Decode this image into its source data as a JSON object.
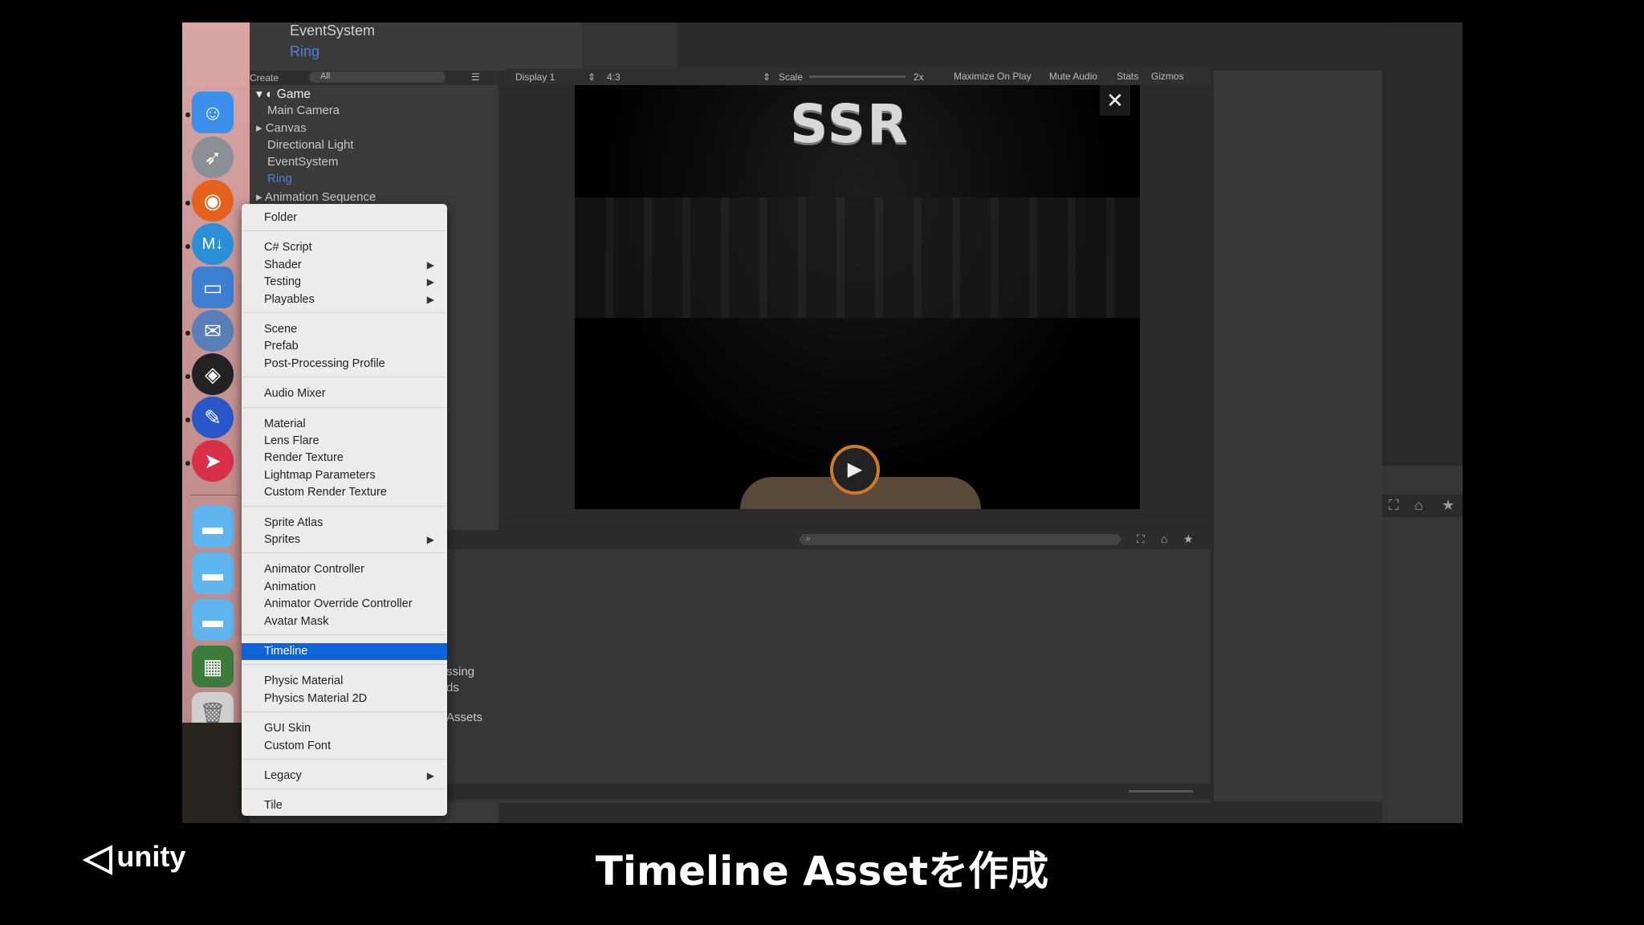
{
  "caption": "Timeline Assetを作成",
  "logo_text": "unity",
  "hierarchy_top": [
    "EventSystem",
    "Ring"
  ],
  "hierarchy_toolbar": {
    "create": "Create",
    "search": "All"
  },
  "hierarchy": {
    "scene": "Game",
    "items": [
      "Main Camera",
      "Canvas",
      "Directional Light",
      "EventSystem",
      "Ring",
      "Animation Sequence"
    ]
  },
  "game_toolbar": {
    "display": "Display 1",
    "aspect": "4:3",
    "scale_label": "Scale",
    "scale_value": "2x",
    "maximize": "Maximize On Play",
    "mute": "Mute Audio",
    "stats": "Stats",
    "gizmos": "Gizmos"
  },
  "game_logo": "SSR",
  "project_fragments": [
    "ssing",
    "ds",
    "Assets"
  ],
  "menu": {
    "groups": [
      [
        {
          "label": "Folder"
        }
      ],
      [
        {
          "label": "C# Script"
        },
        {
          "label": "Shader",
          "sub": true
        },
        {
          "label": "Testing",
          "sub": true
        },
        {
          "label": "Playables",
          "sub": true
        }
      ],
      [
        {
          "label": "Scene"
        },
        {
          "label": "Prefab"
        },
        {
          "label": "Post-Processing Profile"
        }
      ],
      [
        {
          "label": "Audio Mixer"
        }
      ],
      [
        {
          "label": "Material"
        },
        {
          "label": "Lens Flare"
        },
        {
          "label": "Render Texture"
        },
        {
          "label": "Lightmap Parameters"
        },
        {
          "label": "Custom Render Texture"
        }
      ],
      [
        {
          "label": "Sprite Atlas"
        },
        {
          "label": "Sprites",
          "sub": true
        }
      ],
      [
        {
          "label": "Animator Controller"
        },
        {
          "label": "Animation"
        },
        {
          "label": "Animator Override Controller"
        },
        {
          "label": "Avatar Mask"
        }
      ],
      [
        {
          "label": "Timeline",
          "selected": true
        }
      ],
      [
        {
          "label": "Physic Material"
        },
        {
          "label": "Physics Material 2D"
        }
      ],
      [
        {
          "label": "GUI Skin"
        },
        {
          "label": "Custom Font"
        }
      ],
      [
        {
          "label": "Legacy",
          "sub": true
        }
      ],
      [
        {
          "label": "Tile"
        }
      ]
    ]
  },
  "icons": {
    "submenu": "▶",
    "close": "✕",
    "play": "▶"
  }
}
